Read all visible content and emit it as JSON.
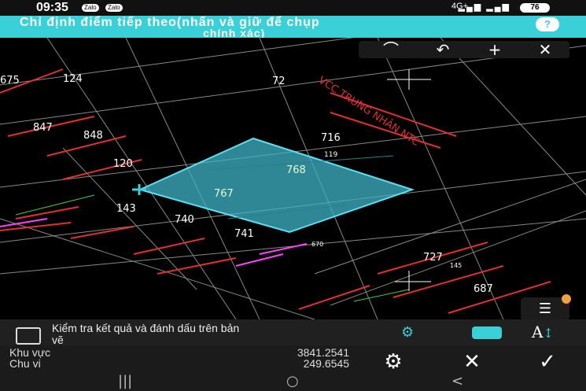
{
  "status_bar": {
    "time": "09:35",
    "chip1": "Zalo",
    "chip2": "Zalo",
    "network": "4G+",
    "battery": "76"
  },
  "banner": {
    "instruction_line1": "Chỉ định điểm tiếp theo(nhấn và giữ để chụp",
    "instruction_line2": "chính xác)",
    "help_label": "?"
  },
  "toolbar": {
    "items": [
      {
        "name": "arc-icon",
        "glyph": "⌒"
      },
      {
        "name": "undo-icon",
        "glyph": "↶"
      },
      {
        "name": "plus-icon",
        "glyph": "+"
      },
      {
        "name": "close-icon",
        "glyph": "✕"
      }
    ]
  },
  "map": {
    "parcel_labels": [
      "675",
      "124",
      "72",
      "847",
      "848",
      "716",
      "119",
      "120",
      "768",
      "767",
      "143",
      "740",
      "741",
      "670",
      "727",
      "145",
      "687"
    ],
    "road_text": "VCC TRUNG NHÂN NTC",
    "selection_fill": "#3fb4c8",
    "selection_stroke": "#5be0f0"
  },
  "bottom_panel": {
    "check_text_line1": "Kiểm tra kết quả và đánh dấu trên bản",
    "check_text_line2": "vẽ",
    "text_size_label": "A",
    "area_label": "Khu vực",
    "area_value": "3841.2541",
    "perimeter_label": "Chu vi",
    "perimeter_value": "249.6545",
    "settings_glyph": "⚙",
    "cancel_glyph": "✕",
    "confirm_glyph": "✓"
  },
  "nav_bar": {
    "recent": "|||",
    "home": "○",
    "back": "<"
  },
  "colors": {
    "accent": "#3ad0d8",
    "line_red": "#e03030",
    "background": "#000000"
  }
}
